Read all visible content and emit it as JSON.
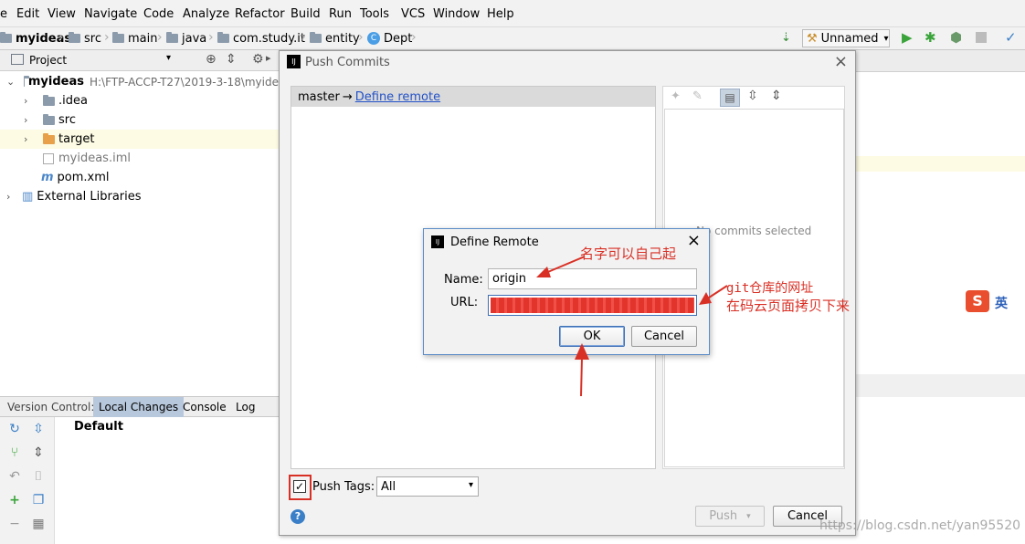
{
  "menu": [
    "e",
    "Edit",
    "View",
    "Navigate",
    "Code",
    "Analyze",
    "Refactor",
    "Build",
    "Run",
    "Tools",
    "VCS",
    "Window",
    "Help"
  ],
  "breadcrumb": [
    "myideas",
    "src",
    "main",
    "java",
    "com.study.it",
    "entity",
    "Dept"
  ],
  "run_config": "Unnamed",
  "project_panel": {
    "title": "Project",
    "root": "myideas",
    "root_path": "H:\\FTP-ACCP-T27\\2019-3-18\\myide",
    "items": [
      ".idea",
      "src",
      "target",
      "myideas.iml",
      "pom.xml",
      "External Libraries"
    ]
  },
  "bottom_panel": {
    "label": "Version Control:",
    "tabs": [
      "Local Changes",
      "Console",
      "Log"
    ],
    "changelist": "Default"
  },
  "push_dialog": {
    "title": "Push Commits",
    "branch": "master",
    "arrow": "→",
    "define_remote": "Define remote",
    "no_commits": "No commits selected",
    "push_tags_label": "Push Tags:",
    "push_tags_value": "All",
    "push_button": "Push",
    "cancel_button": "Cancel",
    "help": "?"
  },
  "define_remote": {
    "title": "Define Remote",
    "name_label": "Name:",
    "name_value": "origin",
    "url_label": "URL:",
    "ok": "OK",
    "cancel": "Cancel"
  },
  "annotations": {
    "name_note": "名字可以自己起",
    "url_note_1": "git仓库的网址",
    "url_note_2": "在码云页面拷贝下来"
  },
  "ime": "英",
  "watermark": "https://blog.csdn.net/yan95520",
  "colors": {
    "annotation": "#d93025",
    "selection": "#b8c8dc",
    "link": "#2352c7"
  }
}
